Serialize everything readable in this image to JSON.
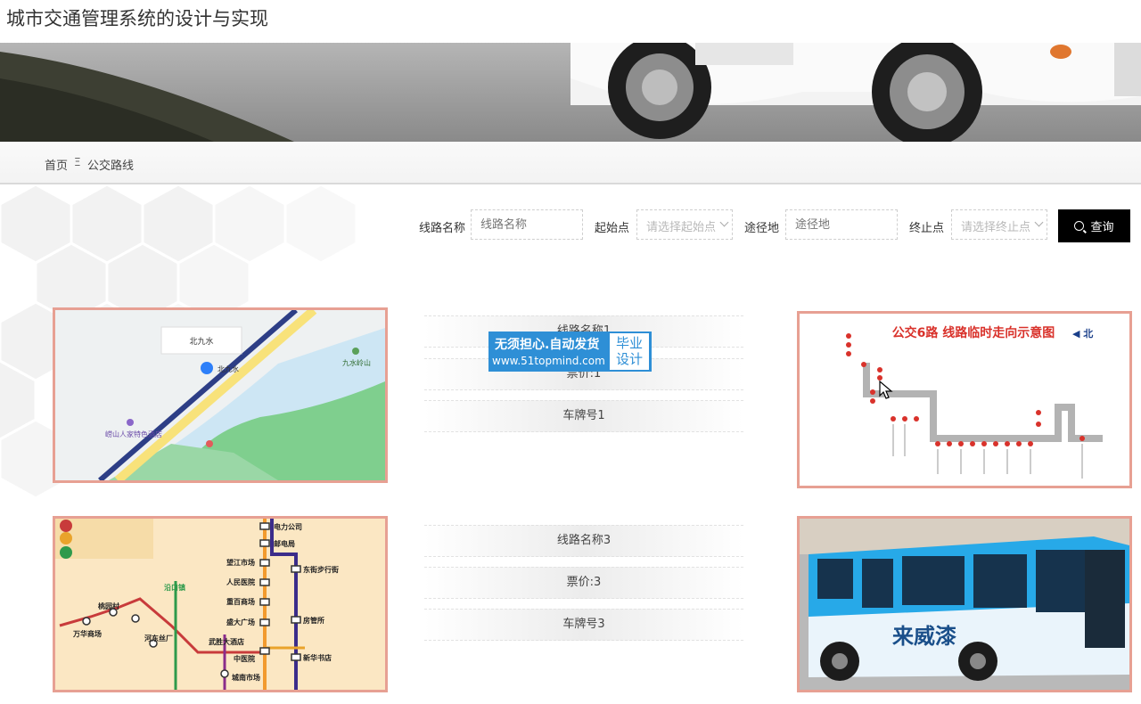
{
  "site": {
    "title": "城市交通管理系统的设计与实现"
  },
  "breadcrumb": {
    "home": "首页",
    "separator": "Ξ",
    "current": "公交路线"
  },
  "search": {
    "route_name_label": "线路名称",
    "route_name_placeholder": "线路名称",
    "start_label": "起始点",
    "start_placeholder": "请选择起始点",
    "via_label": "途径地",
    "via_placeholder": "途径地",
    "end_label": "终止点",
    "end_placeholder": "请选择终止点",
    "button_label": "查询"
  },
  "routes": [
    {
      "name": "线路名称1",
      "fare": "票价:1",
      "plate": "车牌号1"
    },
    {
      "name": "线路名称3",
      "fare": "票价:3",
      "plate": "车牌号3"
    }
  ],
  "images": {
    "map1": {
      "label": "北九水",
      "poi1": "九水岭山",
      "poi2": "崂山人家特色酒店",
      "pin": "北九水"
    },
    "route_diagram": {
      "title": "公交6路 线路临时走向示意图",
      "north": "◀ 北"
    },
    "metro_map": {
      "stations": [
        "电力公司",
        "邮电局",
        "望江市场",
        "人民医院",
        "东街步行街",
        "重百商场",
        "盛大广场",
        "房管所",
        "武胜大酒店",
        "中医院",
        "新华书店",
        "城南市场",
        "万华商场",
        "桃园村",
        "河东丝厂",
        "沿口镇"
      ]
    },
    "bus_photo": {
      "label": "来威漆"
    }
  },
  "watermark": {
    "line1": "无须担心.自动发货",
    "line2": "www.51topmind.com",
    "side": "毕业设计"
  },
  "colors": {
    "accent_border": "#e7a093",
    "button_bg": "#000000",
    "watermark_bg": "#2e8fd6"
  }
}
